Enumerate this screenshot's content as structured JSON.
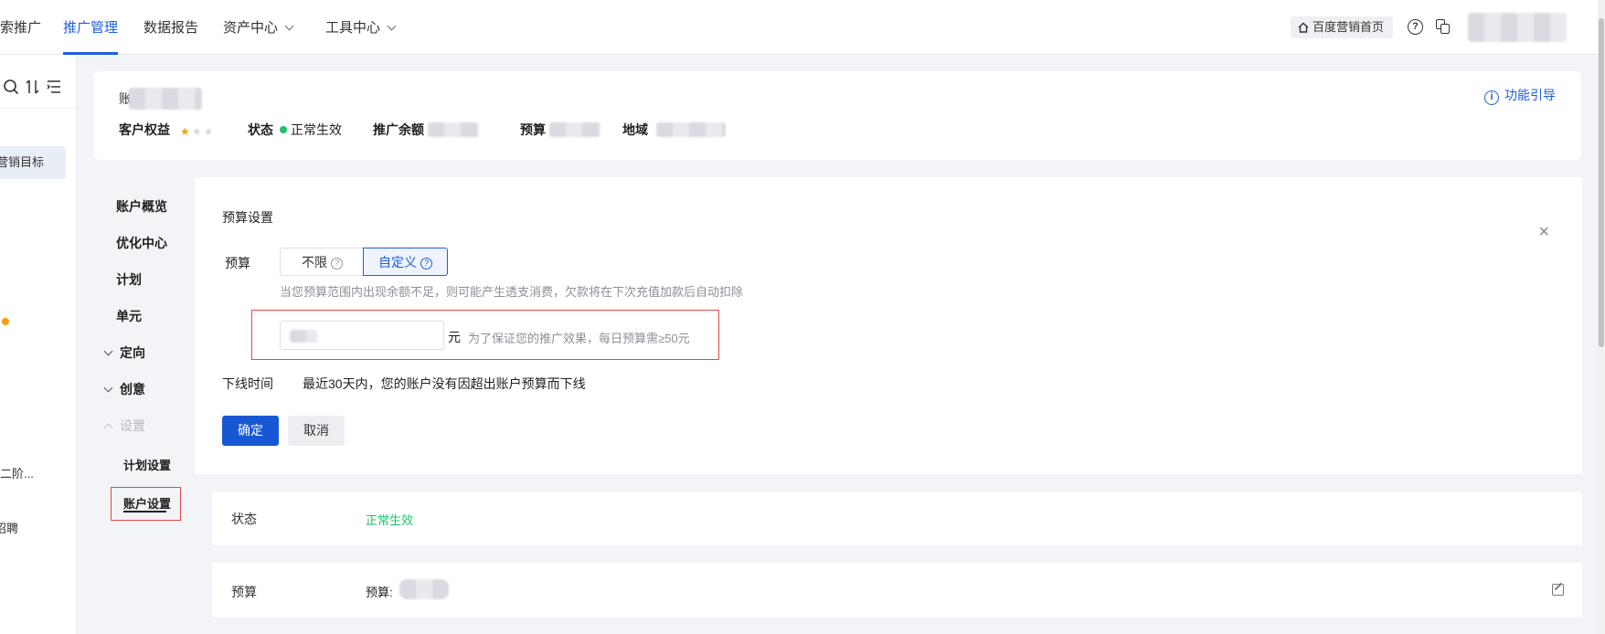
{
  "topnav": {
    "items": [
      {
        "label": "索推广"
      },
      {
        "label": "推广管理"
      },
      {
        "label": "数据报告"
      },
      {
        "label": "资产中心"
      },
      {
        "label": "工具中心"
      }
    ],
    "home_label": "百度营销首页",
    "help_icon": "help-icon",
    "copy_icon": "copy-icon"
  },
  "leftbar": {
    "selected_label": "营销目标",
    "item_stage": "二阶...",
    "item_recruit": "招聘"
  },
  "header": {
    "name_prefix": "账",
    "rights_label": "客户权益",
    "rating": 1,
    "rating_max": 3,
    "status_label": "状态",
    "status_value": "正常生效",
    "balance_label": "推广余额",
    "budget_label": "预算",
    "region_label": "地域",
    "guide_label": "功能引导",
    "status_color": "#1ec06b"
  },
  "side_menu": {
    "overview": "账户概览",
    "optimize": "优化中心",
    "plan": "计划",
    "unit": "单元",
    "targeting": "定向",
    "creative": "创意",
    "settings": "设置",
    "plan_settings": "计划设置",
    "account_settings": "账户设置"
  },
  "panel": {
    "title": "预算设置",
    "budget_label": "预算",
    "option_unlimited": "不限",
    "option_custom": "自定义",
    "hint": "当您预算范围内出现余额不足，则可能产生透支消费，欠款将在下次充值加款后自动扣除",
    "unit": "元",
    "min_hint": "为了保证您的推广效果，每日预算需≥50元",
    "offline_label": "下线时间",
    "offline_value": "最近30天内，您的账户没有因超出账户预算而下线",
    "confirm": "确定",
    "cancel": "取消"
  },
  "info": {
    "status_label": "状态",
    "status_value": "正常生效",
    "budget_label": "预算",
    "budget_value_prefix": "预算:"
  },
  "colors": {
    "accent": "#1f5fdb",
    "primary_button": "#1757d4",
    "highlight_border": "#e24a4a",
    "success": "#1ec06b",
    "star": "#f39c12"
  }
}
